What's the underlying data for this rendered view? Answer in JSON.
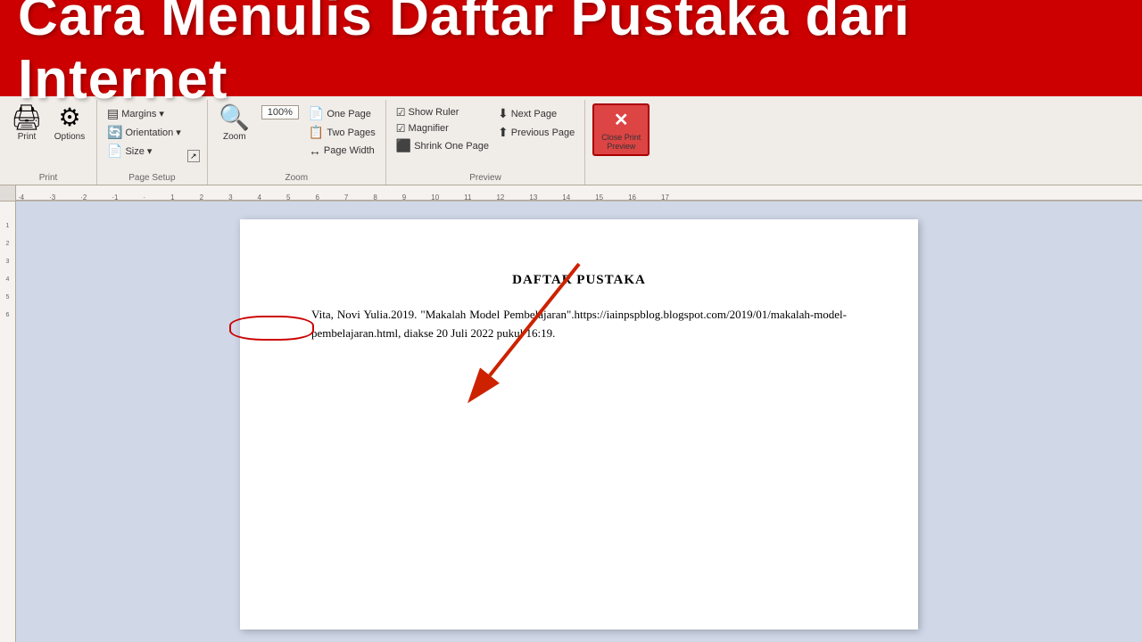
{
  "banner": {
    "title": "Cara Menulis Daftar Pustaka dari Internet"
  },
  "ribbon": {
    "groups": [
      {
        "name": "Print",
        "label": "Print",
        "buttons": [
          {
            "id": "print",
            "icon": "🖨",
            "label": "Print"
          },
          {
            "id": "options",
            "icon": "⚙",
            "label": "Options"
          }
        ]
      },
      {
        "name": "PageSetup",
        "label": "Page Setup",
        "items": [
          {
            "id": "margins",
            "label": "Margins"
          },
          {
            "id": "orientation",
            "label": "Orientation"
          },
          {
            "id": "size",
            "label": "Size"
          }
        ]
      },
      {
        "name": "Zoom",
        "label": "Zoom",
        "items": [
          {
            "id": "zoom",
            "label": "Zoom"
          },
          {
            "id": "zoom-percent",
            "label": "100%"
          },
          {
            "id": "one-page",
            "label": "One Page"
          },
          {
            "id": "two-pages",
            "label": "Two Pages"
          },
          {
            "id": "page-width",
            "label": "Page Width"
          }
        ]
      },
      {
        "name": "Preview",
        "label": "Preview",
        "items": [
          {
            "id": "show-ruler",
            "label": "Show Ruler",
            "checked": true
          },
          {
            "id": "magnifier",
            "label": "Magnifier",
            "checked": true
          },
          {
            "id": "shrink-one-page",
            "label": "Shrink One Page"
          },
          {
            "id": "next-page",
            "label": "Next Page"
          },
          {
            "id": "previous-page",
            "label": "Previous Page"
          }
        ]
      },
      {
        "name": "ClosePrintPreview",
        "label": "Close Print Preview",
        "close_label": "Close Print\nPreview"
      }
    ]
  },
  "document": {
    "title": "DAFTAR PUSTAKA",
    "citation": "Vita, Novi Yulia.2019. \"Makalah Model Pembelajaran\".https://iainpspblog.blogspot.com/2019/01/makalah-model-pembelajaran.html, diakse 20 Juli 2022 pukul 16:19."
  },
  "ruler": {
    "ticks": [
      "-4",
      "-3",
      "-2",
      "-1",
      "0",
      "1",
      "2",
      "3",
      "4",
      "5",
      "6",
      "7",
      "8",
      "9",
      "10",
      "11",
      "12",
      "13",
      "14",
      "15",
      "16",
      "17"
    ]
  },
  "zoom": {
    "percent": "100%"
  }
}
